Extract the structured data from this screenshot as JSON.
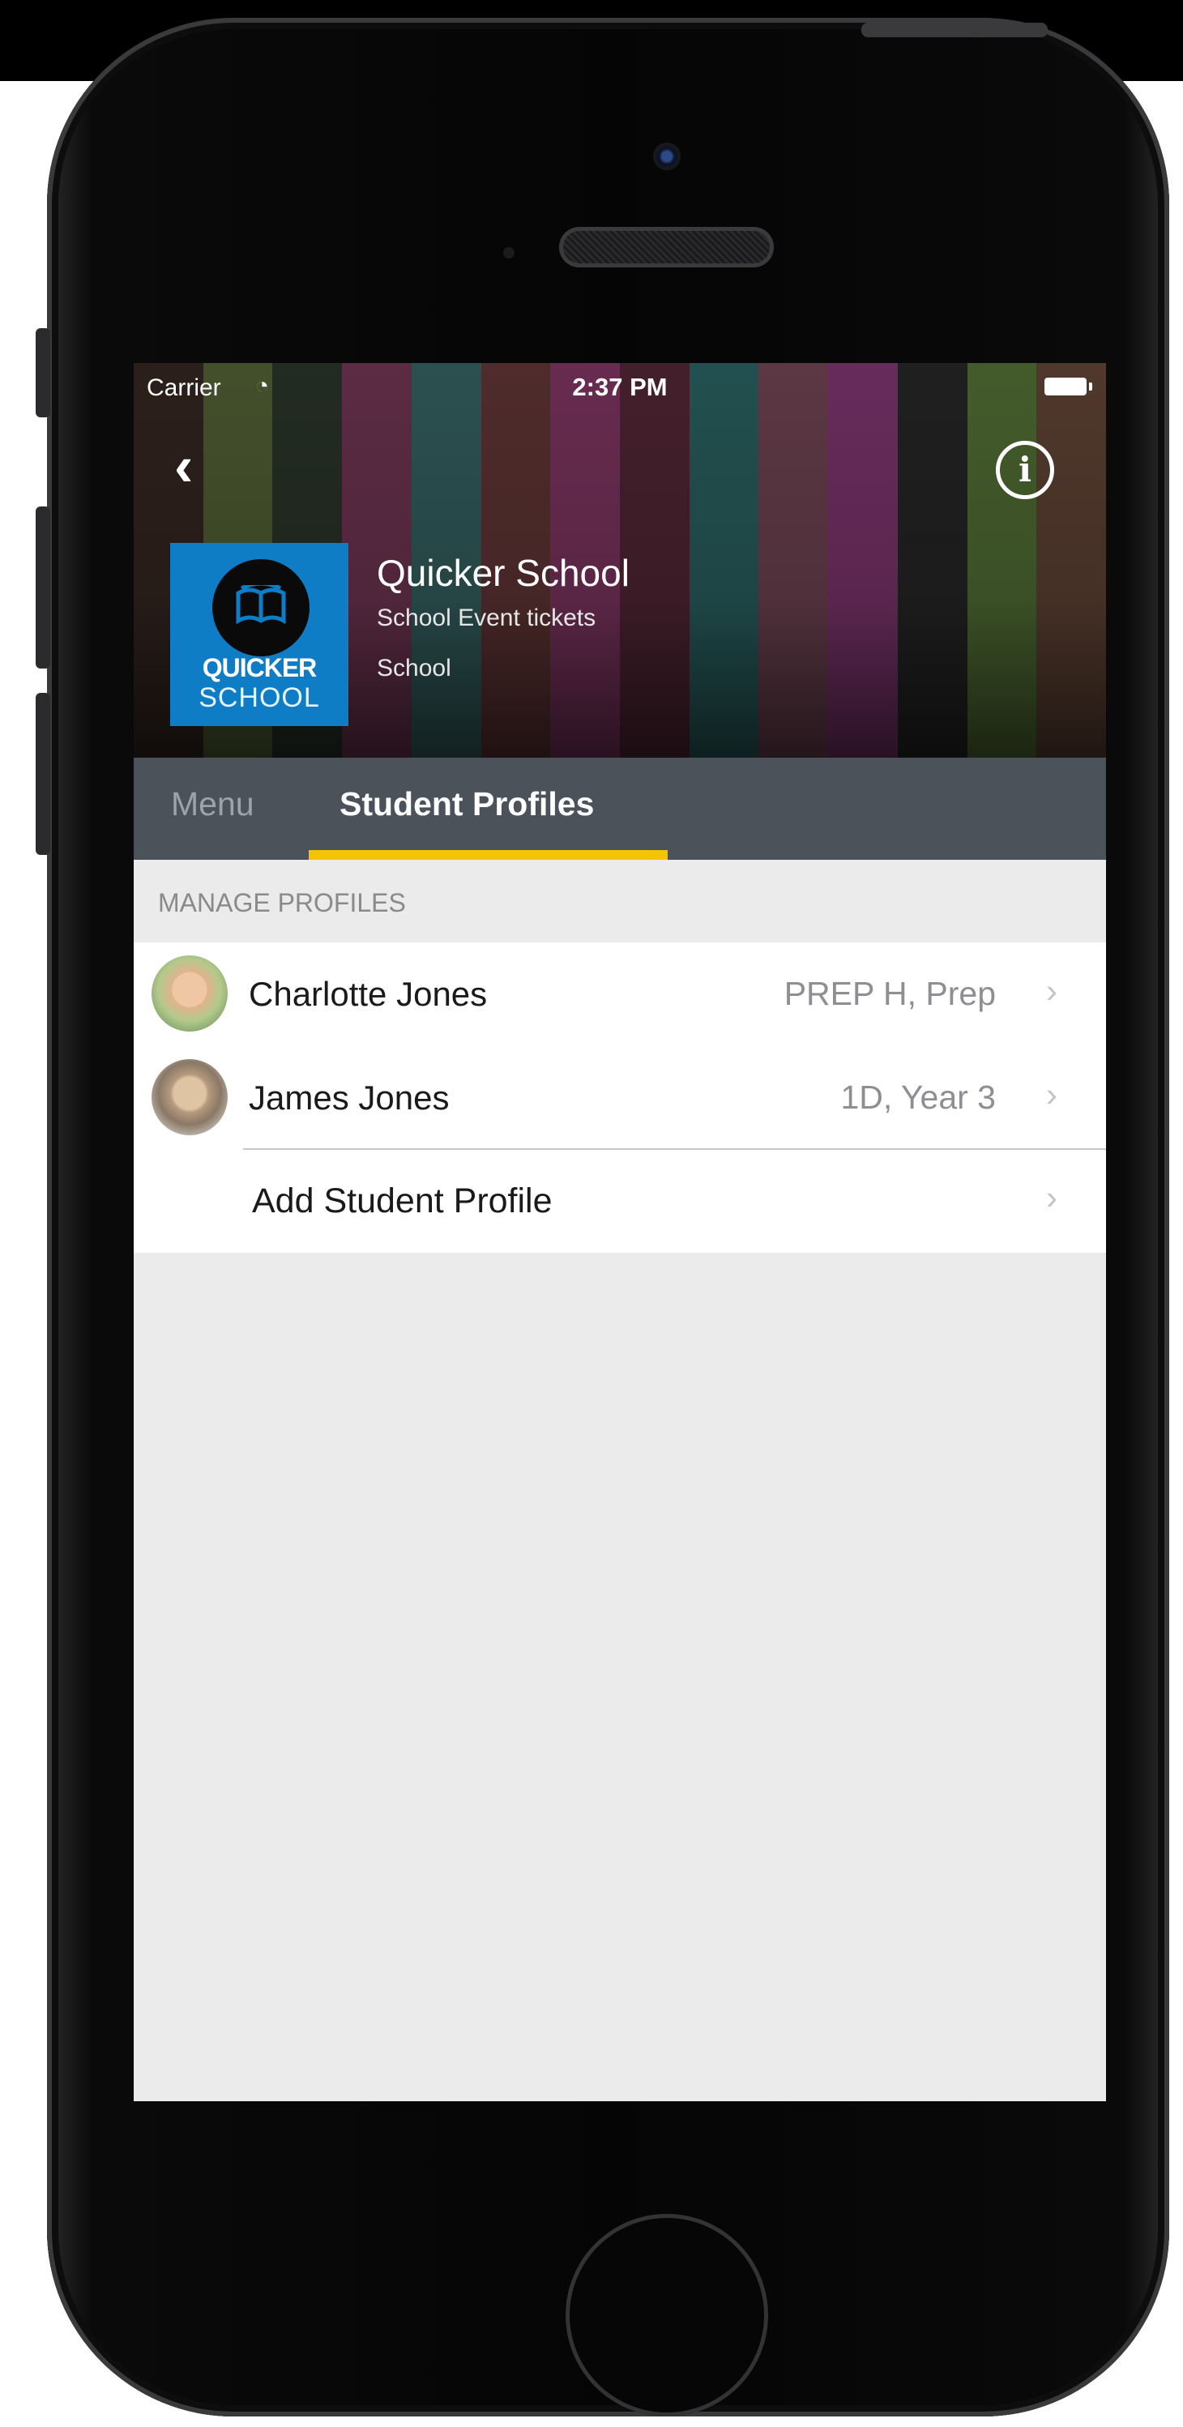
{
  "status_bar": {
    "carrier": "Carrier",
    "time": "2:37 PM"
  },
  "header": {
    "logo_line1": "QUICKER",
    "logo_line2": "SCHOOL",
    "title": "Quicker School",
    "subtitle": "School Event tickets",
    "category": "School"
  },
  "tabs": [
    {
      "label": "Menu",
      "selected": false
    },
    {
      "label": "Student Profiles",
      "selected": true
    }
  ],
  "section": {
    "header": "MANAGE PROFILES",
    "profiles": [
      {
        "name": "Charlotte  Jones",
        "detail": "PREP H, Prep"
      },
      {
        "name": "James Jones",
        "detail": "1D, Year 3"
      }
    ],
    "add_label": "Add Student Profile"
  },
  "colors": {
    "accent": "#f5c400",
    "tabbar": "#4b525a",
    "logo_bg": "#0f7cc6",
    "screen_bg": "#ebebeb"
  },
  "icons": [
    "wifi-icon",
    "battery-icon",
    "back-chevron-icon",
    "info-icon",
    "book-icon",
    "chevron-right-icon"
  ]
}
